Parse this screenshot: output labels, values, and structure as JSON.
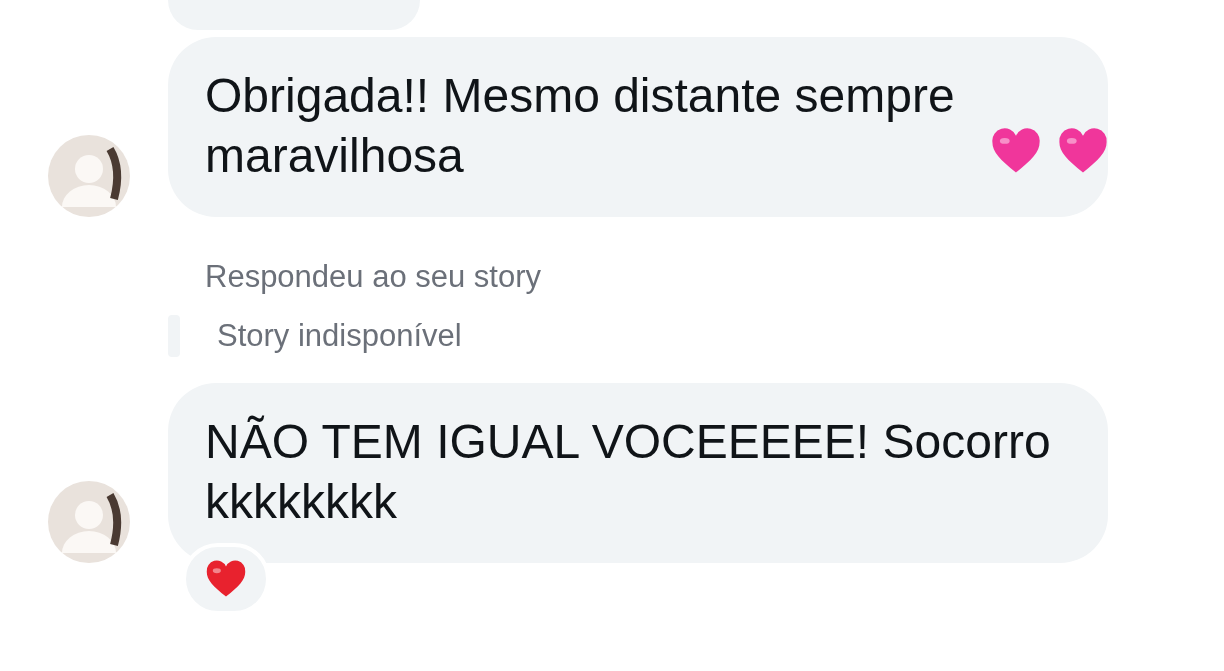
{
  "messages": [
    {
      "kind": "partial"
    },
    {
      "kind": "text",
      "text": "Obrigada!! Mesmo distante sempre maravilhosa",
      "emoji": [
        {
          "kind": "pink-heart"
        },
        {
          "kind": "pink-heart"
        }
      ],
      "avatar": true
    },
    {
      "kind": "story-reply",
      "label": "Respondeu ao seu story",
      "story": "Story indisponível"
    },
    {
      "kind": "text",
      "text": "NÃO TEM IGUAL VOCEEEEE! Socorro kkkkkkkk",
      "avatar": true,
      "reaction": {
        "kind": "red-heart"
      }
    }
  ]
}
